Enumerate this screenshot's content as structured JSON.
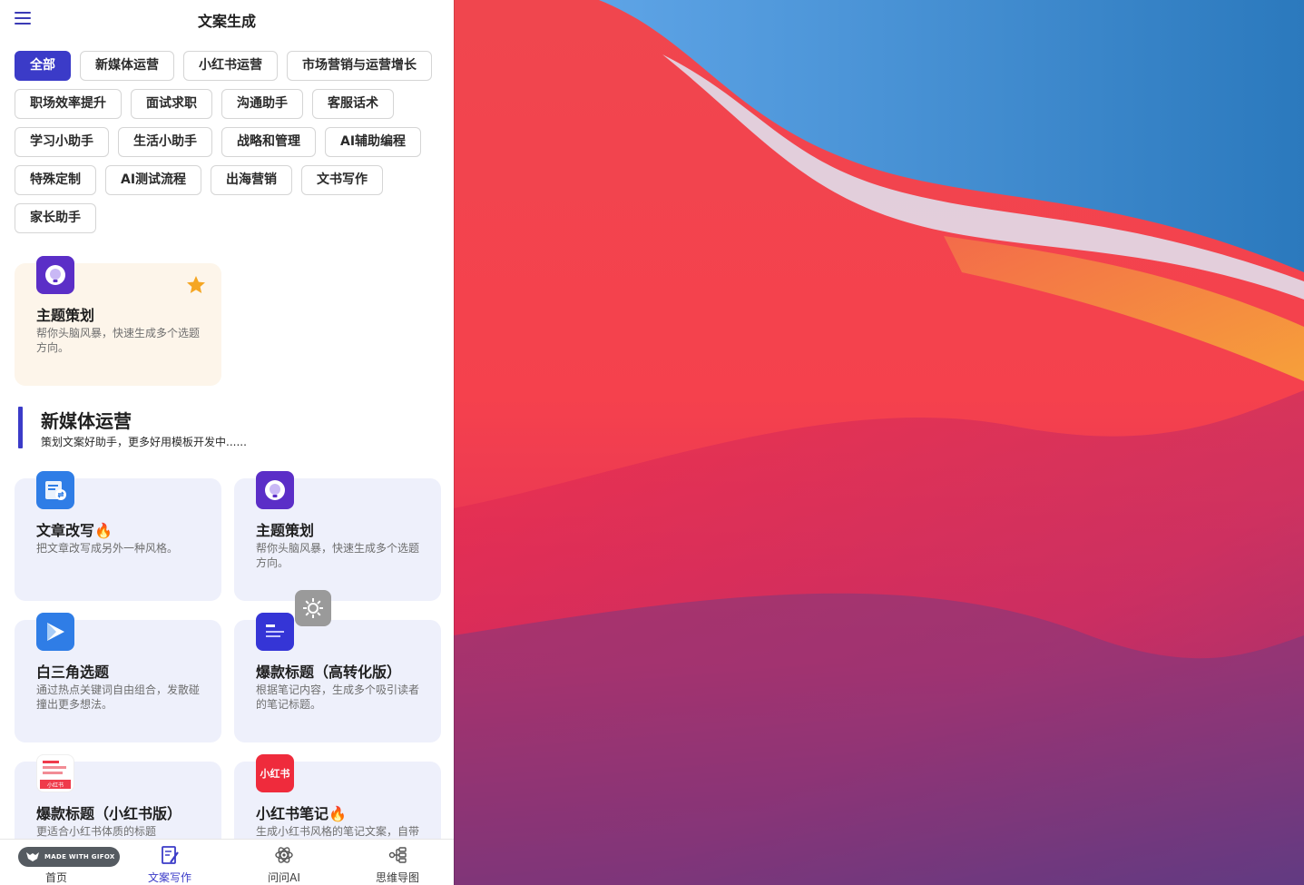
{
  "header": {
    "title": "文案生成"
  },
  "filters": [
    [
      "全部",
      "新媒体运营",
      "小红书运营",
      "市场营销与运营增长"
    ],
    [
      "职场效率提升",
      "面试求职",
      "沟通助手",
      "客服话术"
    ],
    [
      "学习小助手",
      "生活小助手",
      "战略和管理",
      "AI辅助编程"
    ],
    [
      "特殊定制",
      "AI测试流程",
      "出海营销",
      "文书写作"
    ],
    [
      "家长助手"
    ]
  ],
  "active_filter": "全部",
  "favorite": {
    "title": "主题策划",
    "desc": "帮你头脑风暴，快速生成多个选题方向。",
    "icon": "lightbulb-icon"
  },
  "section": {
    "title": "新媒体运营",
    "subtitle": "策划文案好助手，更多好用模板开发中......"
  },
  "cards": [
    {
      "title": "文章改写🔥",
      "desc": "把文章改写成另外一种风格。",
      "icon": "document-swap-icon"
    },
    {
      "title": "主题策划",
      "desc": "帮你头脑风暴，快速生成多个选题方向。",
      "icon": "lightbulb-icon"
    },
    {
      "title": "白三角选题",
      "desc": "通过热点关键词自由组合，发散碰撞出更多想法。",
      "icon": "triangle-icon"
    },
    {
      "title": "爆款标题（高转化版）",
      "desc": "根据笔记内容，生成多个吸引读者的笔记标题。",
      "icon": "headline-icon"
    },
    {
      "title": "爆款标题（小红书版）",
      "desc": "更适合小红书体质的标题",
      "icon": "xhs-headline-icon",
      "icon_caption": "小红书"
    },
    {
      "title": "小红书笔记🔥",
      "desc": "生成小红书风格的笔记文案，自带",
      "icon": "xhs-logo-icon",
      "icon_text": "小红书"
    }
  ],
  "bottom_nav": [
    {
      "label": "首页",
      "icon": "home-icon"
    },
    {
      "label": "文案写作",
      "icon": "writing-icon",
      "active": true
    },
    {
      "label": "问问AI",
      "icon": "atom-icon"
    },
    {
      "label": "思维导图",
      "icon": "mindmap-icon"
    }
  ],
  "watermark": {
    "text": "MADE WITH GIFOX"
  },
  "colors": {
    "accent": "#3b3bc8",
    "favorite_bg": "#fdf5ea",
    "card_bg": "#eef0fb",
    "star": "#f5a623"
  }
}
